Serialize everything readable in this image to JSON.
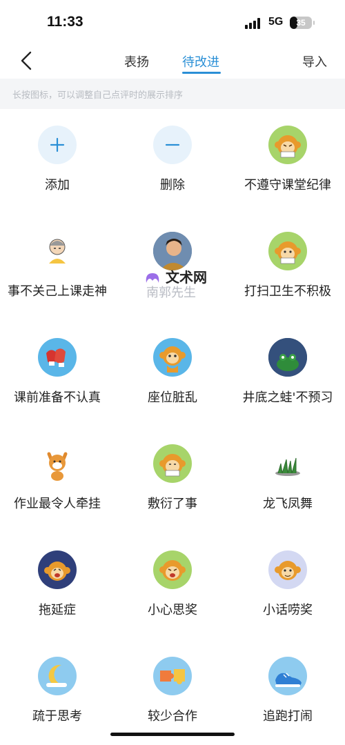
{
  "status_bar": {
    "time": "11:33",
    "network": "5G",
    "battery_percent": "35",
    "battery_level": 0.35
  },
  "nav": {
    "tabs": [
      {
        "label": "表扬",
        "active": false
      },
      {
        "label": "待改进",
        "active": true
      }
    ],
    "import_label": "导入"
  },
  "hint": "长按图标，可以调整自己点评时的展示排序",
  "colors": {
    "accent": "#2a8fd6",
    "hint_bg": "#f4f5f7"
  },
  "items": [
    {
      "label": "添加",
      "icon": "plus-icon"
    },
    {
      "label": "删除",
      "icon": "minus-icon"
    },
    {
      "label": "不遵守课堂纪律",
      "icon": "monkey-reading-icon"
    },
    {
      "label": "事不关己上课走神",
      "icon": "grumpy-man-icon"
    },
    {
      "label": "",
      "icon": "portrait-avatar-icon"
    },
    {
      "label": "打扫卫生不积极",
      "icon": "monkey-reading-icon"
    },
    {
      "label": "课前准备不认真",
      "icon": "boxing-gloves-icon"
    },
    {
      "label": "座位脏乱",
      "icon": "monkey-icon"
    },
    {
      "label": "井底之蛙'不预习",
      "icon": "frog-icon"
    },
    {
      "label": "作业最令人牵挂",
      "icon": "shiba-dog-icon"
    },
    {
      "label": "敷衍了事",
      "icon": "monkey-reading-icon"
    },
    {
      "label": "龙飞凤舞",
      "icon": "grass-icon"
    },
    {
      "label": "拖延症",
      "icon": "monkey-crying-icon"
    },
    {
      "label": "小心思奖",
      "icon": "monkey-laughing-icon"
    },
    {
      "label": "小话唠奖",
      "icon": "monkey-chatter-icon"
    },
    {
      "label": "疏于思考",
      "icon": "moon-icon"
    },
    {
      "label": "较少合作",
      "icon": "puzzle-icon"
    },
    {
      "label": "追跑打闹",
      "icon": "sneaker-icon"
    }
  ],
  "watermark": {
    "title": "文术网",
    "subtitle": "南郭先生"
  }
}
